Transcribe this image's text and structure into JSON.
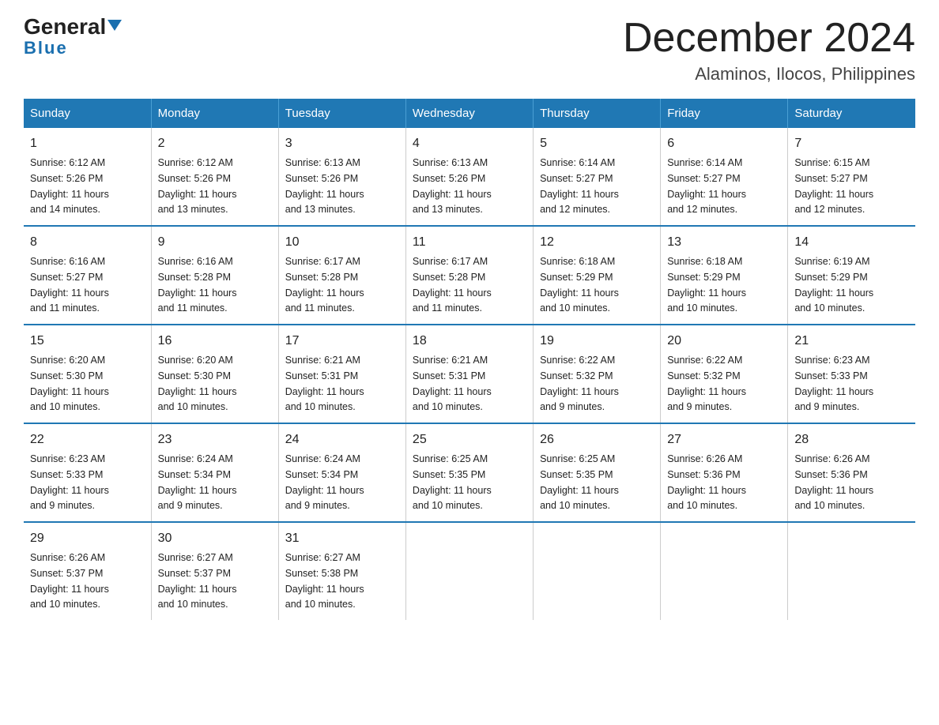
{
  "header": {
    "logo_general": "General",
    "logo_blue": "Blue",
    "title": "December 2024",
    "subtitle": "Alaminos, Ilocos, Philippines"
  },
  "days_of_week": [
    "Sunday",
    "Monday",
    "Tuesday",
    "Wednesday",
    "Thursday",
    "Friday",
    "Saturday"
  ],
  "weeks": [
    [
      {
        "num": "1",
        "sunrise": "6:12 AM",
        "sunset": "5:26 PM",
        "daylight": "11 hours and 14 minutes."
      },
      {
        "num": "2",
        "sunrise": "6:12 AM",
        "sunset": "5:26 PM",
        "daylight": "11 hours and 13 minutes."
      },
      {
        "num": "3",
        "sunrise": "6:13 AM",
        "sunset": "5:26 PM",
        "daylight": "11 hours and 13 minutes."
      },
      {
        "num": "4",
        "sunrise": "6:13 AM",
        "sunset": "5:26 PM",
        "daylight": "11 hours and 13 minutes."
      },
      {
        "num": "5",
        "sunrise": "6:14 AM",
        "sunset": "5:27 PM",
        "daylight": "11 hours and 12 minutes."
      },
      {
        "num": "6",
        "sunrise": "6:14 AM",
        "sunset": "5:27 PM",
        "daylight": "11 hours and 12 minutes."
      },
      {
        "num": "7",
        "sunrise": "6:15 AM",
        "sunset": "5:27 PM",
        "daylight": "11 hours and 12 minutes."
      }
    ],
    [
      {
        "num": "8",
        "sunrise": "6:16 AM",
        "sunset": "5:27 PM",
        "daylight": "11 hours and 11 minutes."
      },
      {
        "num": "9",
        "sunrise": "6:16 AM",
        "sunset": "5:28 PM",
        "daylight": "11 hours and 11 minutes."
      },
      {
        "num": "10",
        "sunrise": "6:17 AM",
        "sunset": "5:28 PM",
        "daylight": "11 hours and 11 minutes."
      },
      {
        "num": "11",
        "sunrise": "6:17 AM",
        "sunset": "5:28 PM",
        "daylight": "11 hours and 11 minutes."
      },
      {
        "num": "12",
        "sunrise": "6:18 AM",
        "sunset": "5:29 PM",
        "daylight": "11 hours and 10 minutes."
      },
      {
        "num": "13",
        "sunrise": "6:18 AM",
        "sunset": "5:29 PM",
        "daylight": "11 hours and 10 minutes."
      },
      {
        "num": "14",
        "sunrise": "6:19 AM",
        "sunset": "5:29 PM",
        "daylight": "11 hours and 10 minutes."
      }
    ],
    [
      {
        "num": "15",
        "sunrise": "6:20 AM",
        "sunset": "5:30 PM",
        "daylight": "11 hours and 10 minutes."
      },
      {
        "num": "16",
        "sunrise": "6:20 AM",
        "sunset": "5:30 PM",
        "daylight": "11 hours and 10 minutes."
      },
      {
        "num": "17",
        "sunrise": "6:21 AM",
        "sunset": "5:31 PM",
        "daylight": "11 hours and 10 minutes."
      },
      {
        "num": "18",
        "sunrise": "6:21 AM",
        "sunset": "5:31 PM",
        "daylight": "11 hours and 10 minutes."
      },
      {
        "num": "19",
        "sunrise": "6:22 AM",
        "sunset": "5:32 PM",
        "daylight": "11 hours and 9 minutes."
      },
      {
        "num": "20",
        "sunrise": "6:22 AM",
        "sunset": "5:32 PM",
        "daylight": "11 hours and 9 minutes."
      },
      {
        "num": "21",
        "sunrise": "6:23 AM",
        "sunset": "5:33 PM",
        "daylight": "11 hours and 9 minutes."
      }
    ],
    [
      {
        "num": "22",
        "sunrise": "6:23 AM",
        "sunset": "5:33 PM",
        "daylight": "11 hours and 9 minutes."
      },
      {
        "num": "23",
        "sunrise": "6:24 AM",
        "sunset": "5:34 PM",
        "daylight": "11 hours and 9 minutes."
      },
      {
        "num": "24",
        "sunrise": "6:24 AM",
        "sunset": "5:34 PM",
        "daylight": "11 hours and 9 minutes."
      },
      {
        "num": "25",
        "sunrise": "6:25 AM",
        "sunset": "5:35 PM",
        "daylight": "11 hours and 10 minutes."
      },
      {
        "num": "26",
        "sunrise": "6:25 AM",
        "sunset": "5:35 PM",
        "daylight": "11 hours and 10 minutes."
      },
      {
        "num": "27",
        "sunrise": "6:26 AM",
        "sunset": "5:36 PM",
        "daylight": "11 hours and 10 minutes."
      },
      {
        "num": "28",
        "sunrise": "6:26 AM",
        "sunset": "5:36 PM",
        "daylight": "11 hours and 10 minutes."
      }
    ],
    [
      {
        "num": "29",
        "sunrise": "6:26 AM",
        "sunset": "5:37 PM",
        "daylight": "11 hours and 10 minutes."
      },
      {
        "num": "30",
        "sunrise": "6:27 AM",
        "sunset": "5:37 PM",
        "daylight": "11 hours and 10 minutes."
      },
      {
        "num": "31",
        "sunrise": "6:27 AM",
        "sunset": "5:38 PM",
        "daylight": "11 hours and 10 minutes."
      },
      null,
      null,
      null,
      null
    ]
  ],
  "labels": {
    "sunrise": "Sunrise:",
    "sunset": "Sunset:",
    "daylight": "Daylight:"
  }
}
